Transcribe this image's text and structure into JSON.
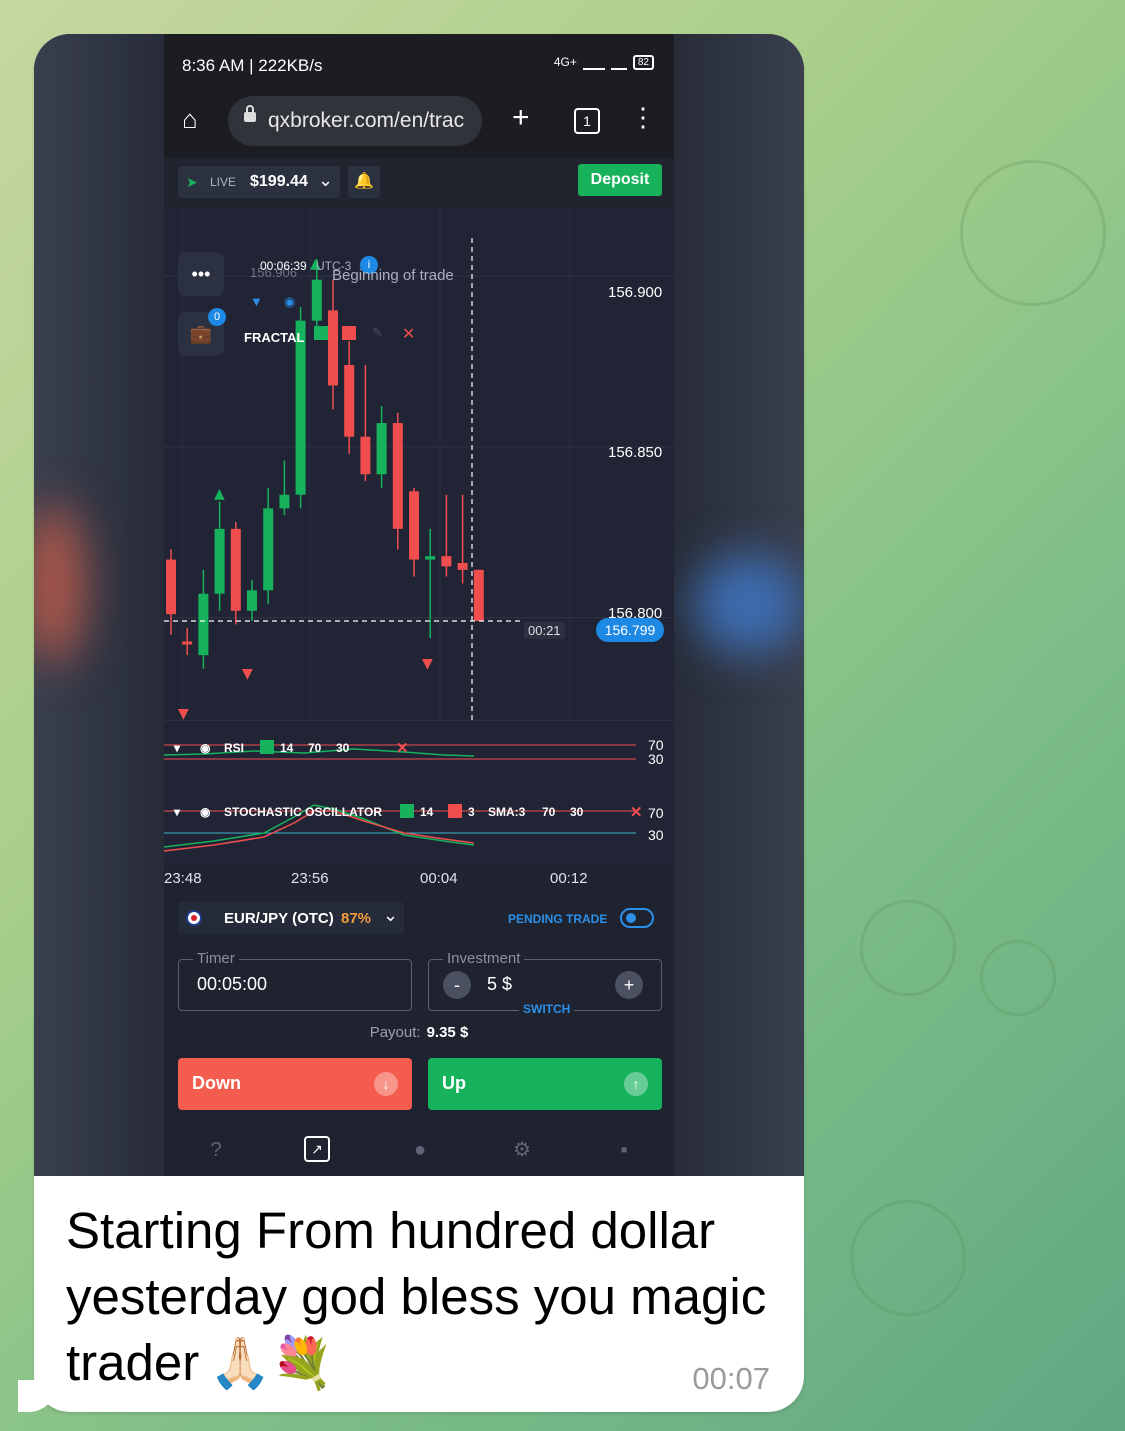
{
  "phone": {
    "status_time": "8:36 AM | 222KB/s",
    "network": "4G+",
    "battery": "82"
  },
  "browser": {
    "url": "qxbroker.com/en/trac",
    "tab_count": "1"
  },
  "toolbar": {
    "account_mode": "LIVE",
    "balance": "$199.44",
    "deposit_label": "Deposit",
    "accent_green": "#19b25c"
  },
  "chart": {
    "overlay_timer": "00:06:39",
    "overlay_tz": "UTC-3",
    "overlay_price_faded": "156.906",
    "beginning_label": "Beginning of trade",
    "fractal_label": "FRACTAL",
    "portfolio_badge": "0",
    "price_levels": [
      "156.900",
      "156.850",
      "156.800"
    ],
    "current_price": "156.799",
    "countdown": "00:21",
    "time_labels": [
      "23:48",
      "23:56",
      "00:04",
      "00:12"
    ]
  },
  "chart_data": {
    "type": "candlestick",
    "ylim": [
      156.77,
      156.92
    ],
    "y_ticks": [
      156.9,
      156.85,
      156.8
    ],
    "current_price": 156.799,
    "candles": [
      {
        "o": 156.817,
        "c": 156.801,
        "h": 156.82,
        "l": 156.795,
        "dir": "down"
      },
      {
        "o": 156.793,
        "c": 156.793,
        "h": 156.797,
        "l": 156.789,
        "dir": "down"
      },
      {
        "o": 156.789,
        "c": 156.807,
        "h": 156.814,
        "l": 156.785,
        "dir": "up"
      },
      {
        "o": 156.807,
        "c": 156.826,
        "h": 156.834,
        "l": 156.802,
        "dir": "up"
      },
      {
        "o": 156.826,
        "c": 156.802,
        "h": 156.828,
        "l": 156.798,
        "dir": "down"
      },
      {
        "o": 156.802,
        "c": 156.808,
        "h": 156.811,
        "l": 156.799,
        "dir": "up"
      },
      {
        "o": 156.808,
        "c": 156.832,
        "h": 156.838,
        "l": 156.804,
        "dir": "up"
      },
      {
        "o": 156.832,
        "c": 156.836,
        "h": 156.846,
        "l": 156.83,
        "dir": "up"
      },
      {
        "o": 156.836,
        "c": 156.887,
        "h": 156.891,
        "l": 156.832,
        "dir": "up"
      },
      {
        "o": 156.887,
        "c": 156.899,
        "h": 156.905,
        "l": 156.882,
        "dir": "up"
      },
      {
        "o": 156.89,
        "c": 156.868,
        "h": 156.899,
        "l": 156.861,
        "dir": "down"
      },
      {
        "o": 156.874,
        "c": 156.853,
        "h": 156.881,
        "l": 156.848,
        "dir": "down"
      },
      {
        "o": 156.853,
        "c": 156.842,
        "h": 156.874,
        "l": 156.84,
        "dir": "down"
      },
      {
        "o": 156.842,
        "c": 156.857,
        "h": 156.862,
        "l": 156.838,
        "dir": "up"
      },
      {
        "o": 156.857,
        "c": 156.826,
        "h": 156.86,
        "l": 156.82,
        "dir": "down"
      },
      {
        "o": 156.837,
        "c": 156.817,
        "h": 156.838,
        "l": 156.812,
        "dir": "down"
      },
      {
        "o": 156.817,
        "c": 156.818,
        "h": 156.826,
        "l": 156.794,
        "dir": "up"
      },
      {
        "o": 156.818,
        "c": 156.815,
        "h": 156.836,
        "l": 156.812,
        "dir": "down"
      },
      {
        "o": 156.816,
        "c": 156.814,
        "h": 156.836,
        "l": 156.81,
        "dir": "down"
      },
      {
        "o": 156.814,
        "c": 156.799,
        "h": 156.814,
        "l": 156.799,
        "dir": "down"
      }
    ]
  },
  "indicators": {
    "rsi_label": "RSI",
    "rsi_period": "14",
    "rsi_upper": "70",
    "rsi_lower": "30",
    "stoch_label": "STOCHASTIC OSCILLATOR",
    "stoch_k": "14",
    "stoch_d": "3",
    "stoch_sma": "SMA:3",
    "stoch_upper": "70",
    "stoch_lower": "30"
  },
  "trade": {
    "pair": "EUR/JPY (OTC)",
    "payout_pct": "87%",
    "pending_label": "PENDING TRADE",
    "timer_legend": "Timer",
    "timer_value": "00:05:00",
    "investment_legend": "Investment",
    "investment_value": "5 $",
    "switch_label": "SWITCH",
    "payout_label": "Payout:",
    "payout_value": "9.35 $",
    "down_label": "Down",
    "up_label": "Up"
  },
  "message": {
    "text_line1": "Starting From hundred dollar",
    "text_line2": "yesterday god bless you magic",
    "text_line3": "trader",
    "emojis": "🙏🏻💐",
    "time": "00:07"
  }
}
